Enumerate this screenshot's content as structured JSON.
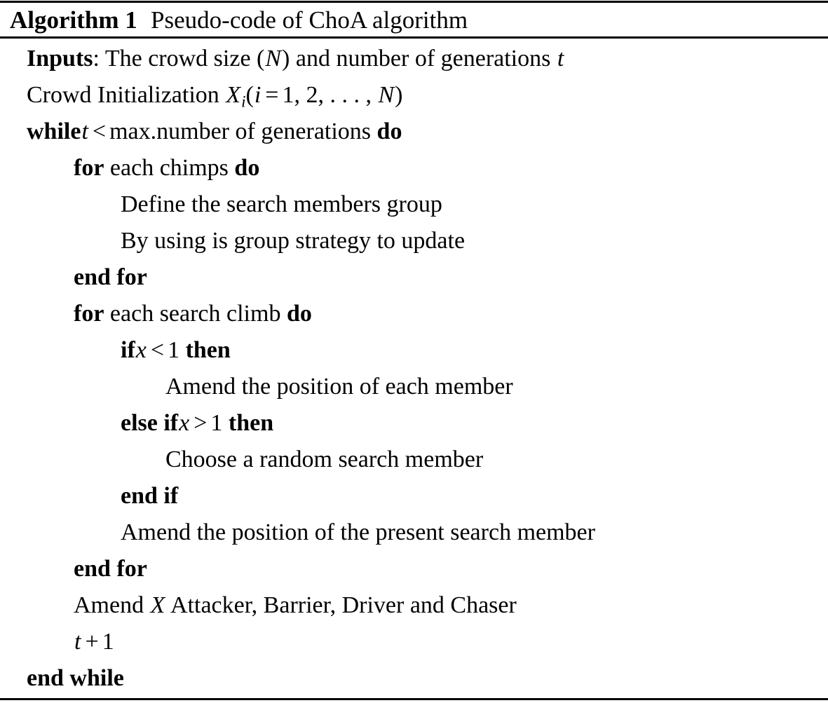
{
  "document": {
    "kind": "latex-algorithm-float",
    "header": {
      "label": "Algorithm 1",
      "caption": "Pseudo-code of ChoA algorithm",
      "full_text": "Algorithm 1 Pseudo-code of ChoA algorithm"
    },
    "rules": {
      "top": "solid",
      "below_header": "solid",
      "bottom": "solid",
      "color": "#000000"
    },
    "body": {
      "lines": [
        {
          "index": 1,
          "indent": 0,
          "text": "Inputs: The crowd size (N) and number of generations t",
          "parts": [
            {
              "kind": "keyword",
              "text": "Inputs"
            },
            {
              "kind": "text",
              "text": ": The crowd size ("
            },
            {
              "kind": "math",
              "text": "N"
            },
            {
              "kind": "text",
              "text": ") and number of generations "
            },
            {
              "kind": "math",
              "text": "t"
            }
          ]
        },
        {
          "index": 2,
          "indent": 0,
          "text": "Crowd Initialization Xi(i = 1, 2, . . . , N)",
          "parts": [
            {
              "kind": "text",
              "text": "Crowd Initialization "
            },
            {
              "kind": "math",
              "text": "X"
            },
            {
              "kind": "subscript",
              "text": "i"
            },
            {
              "kind": "text",
              "text": "("
            },
            {
              "kind": "math",
              "text": "i"
            },
            {
              "kind": "op",
              "text": "="
            },
            {
              "kind": "text",
              "text": "1, 2, . . . , "
            },
            {
              "kind": "math",
              "text": "N"
            },
            {
              "kind": "text",
              "text": ")"
            }
          ]
        },
        {
          "index": 3,
          "indent": 0,
          "text": "while t < max.number of generations do",
          "parts": [
            {
              "kind": "keyword",
              "text": "while"
            },
            {
              "kind": "math",
              "text": "t"
            },
            {
              "kind": "op",
              "text": "<"
            },
            {
              "kind": "text",
              "text": "max.number of generations "
            },
            {
              "kind": "keyword",
              "text": "do"
            }
          ]
        },
        {
          "index": 4,
          "indent": 1,
          "text": "for each chimps do",
          "parts": [
            {
              "kind": "keyword",
              "text": "for"
            },
            {
              "kind": "text",
              "text": " each chimps "
            },
            {
              "kind": "keyword",
              "text": "do"
            }
          ]
        },
        {
          "index": 5,
          "indent": 2,
          "text": "Define the search members group",
          "parts": [
            {
              "kind": "text",
              "text": "Define the search members group"
            }
          ]
        },
        {
          "index": 6,
          "indent": 2,
          "text": "By using is group strategy to update",
          "parts": [
            {
              "kind": "text",
              "text": "By using is group strategy to update"
            }
          ]
        },
        {
          "index": 7,
          "indent": 1,
          "text": "end for",
          "parts": [
            {
              "kind": "keyword",
              "text": "end for"
            }
          ]
        },
        {
          "index": 8,
          "indent": 1,
          "text": "for each search climb do",
          "parts": [
            {
              "kind": "keyword",
              "text": "for"
            },
            {
              "kind": "text",
              "text": " each search climb "
            },
            {
              "kind": "keyword",
              "text": "do"
            }
          ]
        },
        {
          "index": 9,
          "indent": 2,
          "text": "if x < 1 then",
          "parts": [
            {
              "kind": "keyword",
              "text": "if"
            },
            {
              "kind": "math",
              "text": "x"
            },
            {
              "kind": "op",
              "text": "<"
            },
            {
              "kind": "text",
              "text": "1 "
            },
            {
              "kind": "keyword",
              "text": "then"
            }
          ]
        },
        {
          "index": 10,
          "indent": 3,
          "text": "Amend the position of each member",
          "parts": [
            {
              "kind": "text",
              "text": "Amend the position of each member"
            }
          ]
        },
        {
          "index": 11,
          "indent": 2,
          "text": "else if x > 1 then",
          "parts": [
            {
              "kind": "keyword",
              "text": "else if"
            },
            {
              "kind": "math",
              "text": "x"
            },
            {
              "kind": "op",
              "text": ">"
            },
            {
              "kind": "text",
              "text": "1 "
            },
            {
              "kind": "keyword",
              "text": "then"
            }
          ]
        },
        {
          "index": 12,
          "indent": 3,
          "text": "Choose a random search member",
          "parts": [
            {
              "kind": "text",
              "text": "Choose a random search member"
            }
          ]
        },
        {
          "index": 13,
          "indent": 2,
          "text": "end if",
          "parts": [
            {
              "kind": "keyword",
              "text": "end if"
            }
          ]
        },
        {
          "index": 14,
          "indent": 2,
          "text": "Amend the position of the present search member",
          "parts": [
            {
              "kind": "text",
              "text": "Amend the position of the present search member"
            }
          ]
        },
        {
          "index": 15,
          "indent": 1,
          "text": "end for",
          "parts": [
            {
              "kind": "keyword",
              "text": "end for"
            }
          ]
        },
        {
          "index": 16,
          "indent": 1,
          "text": "Amend X Attacker, Barrier, Driver and Chaser",
          "parts": [
            {
              "kind": "text",
              "text": "Amend "
            },
            {
              "kind": "math",
              "text": "X"
            },
            {
              "kind": "text",
              "text": " Attacker, Barrier, Driver and Chaser"
            }
          ]
        },
        {
          "index": 17,
          "indent": 1,
          "text": "t + 1",
          "parts": [
            {
              "kind": "math",
              "text": "t"
            },
            {
              "kind": "op",
              "text": "+"
            },
            {
              "kind": "text",
              "text": "1"
            }
          ]
        },
        {
          "index": 18,
          "indent": 0,
          "text": "end while",
          "parts": [
            {
              "kind": "keyword",
              "text": "end while"
            }
          ]
        }
      ]
    }
  }
}
